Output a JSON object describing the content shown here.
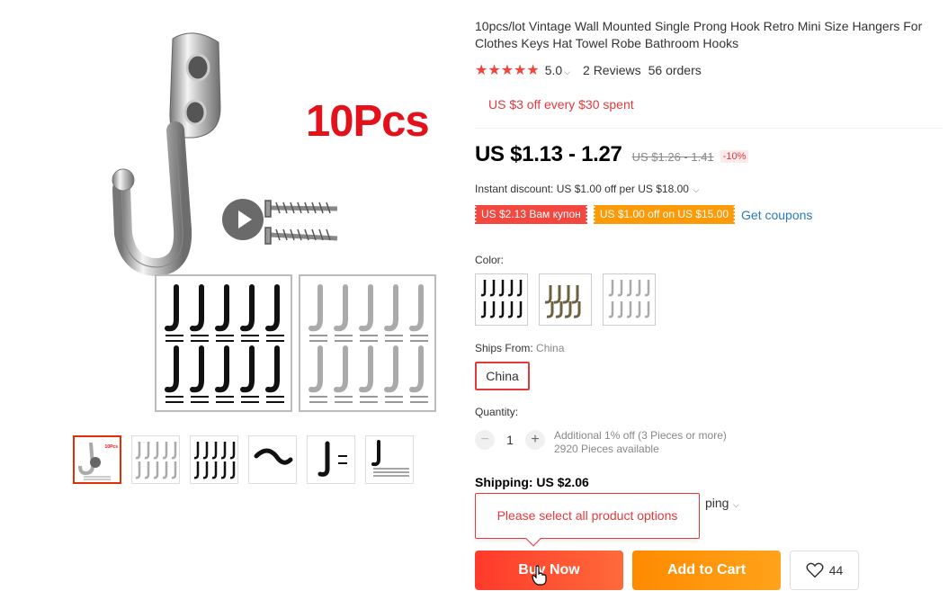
{
  "product": {
    "title": "10pcs/lot Vintage Wall Mounted Single Prong Hook Retro Mini Size Hangers For Clothes Keys Hat Towel Robe Bathroom Hooks",
    "image_overlay_text": "10Pcs",
    "rating": "5.0",
    "stars": "★★★★★",
    "reviews": "2 Reviews",
    "orders": "56 orders",
    "promo": "US $3 off every $30 spent",
    "price": "US $1.13 - 1.27",
    "old_price": "US $1.26 - 1.41",
    "discount": "-10%",
    "instant_discount": "Instant discount: US $1.00 off per US $18.00",
    "coupons": [
      "US $2.13 Вам купон",
      "US $1.00 off on US $15.00"
    ],
    "get_coupons": "Get coupons",
    "thumb_badge": "10Pcs",
    "color_label": "Color:",
    "ships_from_label": "Ships From:",
    "ships_from_value": "China",
    "ship_option": "China",
    "quantity_label": "Quantity:",
    "quantity": "1",
    "quantity_minus": "−",
    "quantity_plus": "+",
    "quantity_discount": "Additional 1% off (3 Pieces or more)",
    "pieces_available": "2920 Pieces available",
    "shipping": "Shipping: US $2.06",
    "shipping_detail": "ping",
    "tooltip": "Please select all product options",
    "buy_now": "Buy Now",
    "add_to_cart": "Add to Cart",
    "wishlist_count": "44"
  },
  "colors": {
    "accent": "#e4393c",
    "buy_now": "#ff4a2b",
    "add_to_cart": "#ff9a0f",
    "coupon_red": "#f44740",
    "coupon_orange": "#fd9a07",
    "link": "#2a7ab8"
  }
}
